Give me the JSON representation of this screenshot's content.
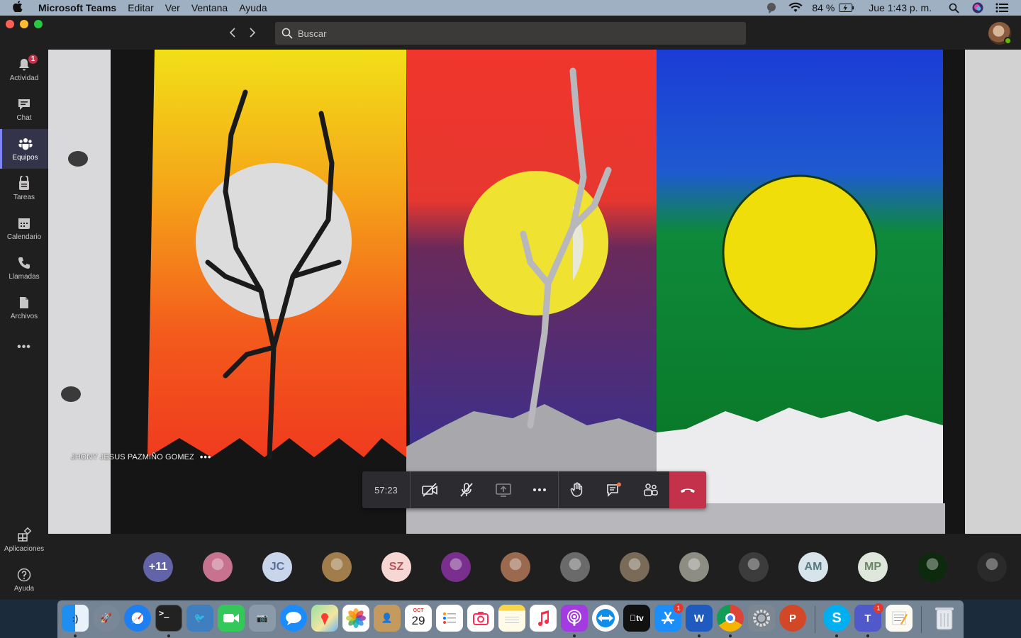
{
  "menubar": {
    "app_name": "Microsoft Teams",
    "menus": [
      "Editar",
      "Ver",
      "Ventana",
      "Ayuda"
    ],
    "battery": "84 %",
    "clock": "Jue 1:43 p. m."
  },
  "titlebar": {
    "search_placeholder": "Buscar"
  },
  "rail": {
    "items": [
      {
        "label": "Actividad",
        "icon": "bell-icon",
        "badge": "1"
      },
      {
        "label": "Chat",
        "icon": "chat-icon"
      },
      {
        "label": "Equipos",
        "icon": "teams-icon",
        "active": true
      },
      {
        "label": "Tareas",
        "icon": "tasks-icon"
      },
      {
        "label": "Calendario",
        "icon": "calendar-icon"
      },
      {
        "label": "Llamadas",
        "icon": "phone-icon"
      },
      {
        "label": "Archivos",
        "icon": "files-icon"
      }
    ],
    "more_label": "•••",
    "bottom": [
      {
        "label": "Aplicaciones",
        "icon": "apps-icon"
      },
      {
        "label": "Ayuda",
        "icon": "help-icon"
      }
    ]
  },
  "call": {
    "speaker_name": "JHONY JESUS PAZMIÑO GOMEZ",
    "speaker_more": "•••",
    "timer": "57:23"
  },
  "participants": [
    {
      "initials": "+11",
      "bg": "#6264a7",
      "fg": "#ffffff"
    },
    {
      "initials": "",
      "bg": "#c7728f"
    },
    {
      "initials": "JC",
      "bg": "#c9d5ea",
      "fg": "#5a6f95"
    },
    {
      "initials": "",
      "bg": "#a07d4a"
    },
    {
      "initials": "SZ",
      "bg": "#f7d7d3",
      "fg": "#b5545b"
    },
    {
      "initials": "",
      "bg": "#7a2f8e"
    },
    {
      "initials": "",
      "bg": "#9b6a4e"
    },
    {
      "initials": "",
      "bg": "#6a6a6a"
    },
    {
      "initials": "",
      "bg": "#7a6a58"
    },
    {
      "initials": "",
      "bg": "#8d8d84"
    },
    {
      "initials": "",
      "bg": "#3c3c3c"
    },
    {
      "initials": "AM",
      "bg": "#d7e4ea",
      "fg": "#587a86"
    },
    {
      "initials": "MP",
      "bg": "#dfe7dc",
      "fg": "#6a8766"
    },
    {
      "initials": "",
      "bg": "#0e2a0e"
    },
    {
      "initials": "",
      "bg": "#2a2a2a"
    }
  ],
  "dock": {
    "calendar_month": "OCT",
    "calendar_day": "29",
    "badges": {
      "appstore": "1",
      "teams": "1"
    }
  }
}
